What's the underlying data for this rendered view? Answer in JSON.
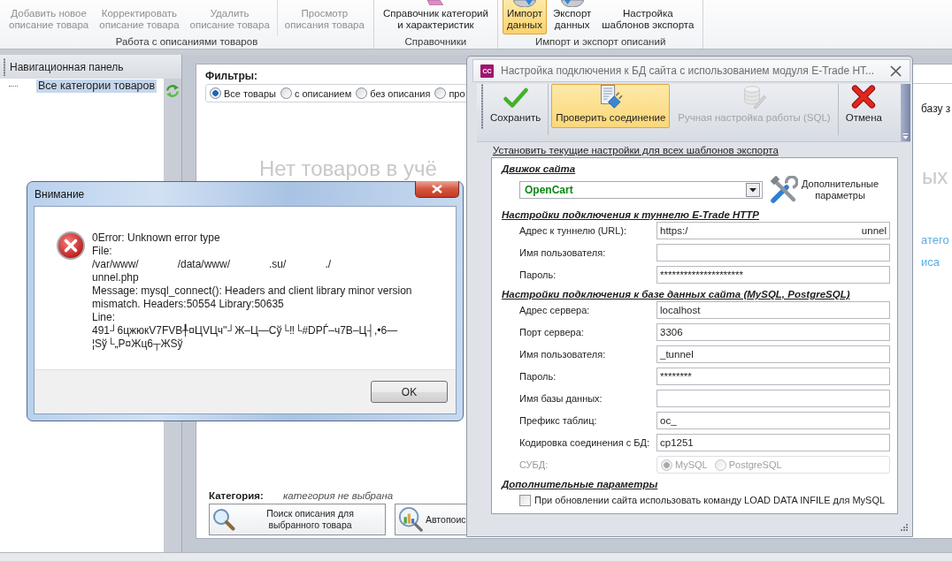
{
  "ribbon": {
    "groups": [
      {
        "label": "Работа с описаниями товаров",
        "sections": [
          {
            "buttons": [
              {
                "kind": "plain",
                "label": "Добавить новое\nописание товара",
                "disabled": true,
                "selected": false
              },
              {
                "kind": "plain",
                "label": "Корректировать\nописание товара",
                "disabled": true,
                "selected": false
              },
              {
                "kind": "plain",
                "label": "Удалить\nописание товара",
                "disabled": true,
                "selected": false
              }
            ]
          },
          {
            "buttons": [
              {
                "kind": "plain",
                "label": "Просмотр\nописания товара",
                "disabled": true,
                "selected": false
              }
            ]
          }
        ]
      },
      {
        "label": "Справочники",
        "sections": [
          {
            "buttons": [
              {
                "kind": "book",
                "label": "Справочник категорий\nи характеристик",
                "disabled": false,
                "selected": false
              }
            ]
          }
        ]
      },
      {
        "label": "Импорт и экспорт описаний",
        "sections": [
          {
            "buttons": [
              {
                "kind": "import",
                "label": "Импорт\nданных",
                "disabled": false,
                "selected": true
              },
              {
                "kind": "export",
                "label": "Экспорт\nданных",
                "disabled": false,
                "selected": false
              },
              {
                "kind": "plain",
                "label": "Настройка\nшаблонов экспорта",
                "disabled": false,
                "selected": false
              }
            ]
          }
        ]
      }
    ]
  },
  "nav_panel": {
    "title": "Навигационная панель",
    "tree": [
      {
        "label": "Все категории товаров",
        "selected": true
      }
    ]
  },
  "filters": {
    "title": "Фильтры:",
    "options": [
      {
        "label": "Все товары",
        "selected": true
      },
      {
        "label": "с описанием",
        "selected": false
      },
      {
        "label": "без описания",
        "selected": false
      },
      {
        "label": "про",
        "selected": false
      }
    ]
  },
  "empty_state": "Нет товаров в учё",
  "category": {
    "label": "Категория:",
    "value": "категория не выбрана"
  },
  "actions": [
    {
      "kind": "search",
      "label": "Поиск описания для\nвыбранного товара"
    },
    {
      "kind": "auto_search",
      "label": "Автопоис"
    }
  ],
  "right_edge": {
    "hint": "базу з",
    "empty_state": "ых",
    "links": [
      "атего",
      "иса"
    ]
  },
  "error_dialog": {
    "title": "Внимание",
    "lines": [
      {
        "kind": "text",
        "text": "0Error: Unknown error type"
      },
      {
        "kind": "text",
        "text": "File:"
      },
      {
        "kind": "gapped",
        "parts": [
          "/var/www/",
          "/data/www/",
          ".su/",
          "./"
        ]
      },
      {
        "kind": "text",
        "text": "unnel.php"
      },
      {
        "kind": "text",
        "text": "Message: mysql_connect(): Headers and client library minor version"
      },
      {
        "kind": "text",
        "text": "mismatch. Headers:50554 Library:50635"
      },
      {
        "kind": "text",
        "text": "Line:"
      },
      {
        "kind": "text",
        "text": "491┘6цжюкV7FVB╀¤ЦVЦч''┘Ж–Ц—Сў└‼└#DPЃ–ч7В–Ц┤,•6—¦Sў└„Р¤Жц6┬ЖSў"
      }
    ],
    "ok_button": "OK"
  },
  "connection_dialog": {
    "logo": "CC",
    "title": "Настройка подключения к БД сайта с использованием модуля E-Trade HT...",
    "toolbar_groups": [
      {
        "buttons": [
          {
            "kind": "save",
            "label": "Сохранить",
            "selected": false,
            "disabled": false
          }
        ]
      },
      {
        "buttons": [
          {
            "kind": "test",
            "label": "Проверить соединение",
            "selected": true,
            "disabled": false
          },
          {
            "kind": "sql",
            "label": "Ручная настройка работы (SQL)",
            "selected": false,
            "disabled": true
          }
        ]
      },
      {
        "buttons": [
          {
            "kind": "cancel",
            "label": "Отмена",
            "selected": false,
            "disabled": false
          }
        ]
      }
    ],
    "apply_link": "Установить текущие настройки для всех шаблонов экспорта",
    "engine": {
      "title": "Движок сайта",
      "value": "OpenCart",
      "extra_button": "Дополнительные\nпараметры"
    },
    "sections": [
      {
        "title": "Настройки подключения к туннелю E-Trade HTTP",
        "fields": [
          {
            "kind": "text",
            "label": "Адрес к туннелю (URL):",
            "value_parts": [
              "https:/",
              "unnel"
            ],
            "disabled": false
          },
          {
            "kind": "text",
            "label": "Имя пользователя:",
            "disabled": false
          },
          {
            "kind": "text",
            "label": "Пароль:",
            "value": "*********************",
            "disabled": false
          }
        ]
      },
      {
        "title": "Настройки подключения к базе данных сайта (MySQL, PostgreSQL)",
        "fields": [
          {
            "kind": "text",
            "label": "Адрес сервера:",
            "value": "localhost",
            "disabled": false
          },
          {
            "kind": "text",
            "label": "Порт сервера:",
            "value": "3306",
            "disabled": false
          },
          {
            "kind": "text",
            "label": "Имя пользователя:",
            "value": "_tunnel",
            "disabled": false
          },
          {
            "kind": "text",
            "label": "Пароль:",
            "value": "********",
            "disabled": false
          },
          {
            "kind": "text",
            "label": "Имя базы данных:",
            "disabled": false
          },
          {
            "kind": "text",
            "label": "Префикс таблиц:",
            "value": "oc_",
            "disabled": false
          },
          {
            "kind": "text",
            "label": "Кодировка соединения с БД:",
            "value": "cp1251",
            "disabled": false
          },
          {
            "kind": "radio",
            "label": "СУБД:",
            "disabled": true,
            "options": [
              {
                "label": "MySQL",
                "selected": true
              },
              {
                "label": "PostgreSQL",
                "selected": false
              }
            ]
          }
        ]
      },
      {
        "title": "Дополнительные параметры",
        "fields": [
          {
            "kind": "checkbox",
            "label": "При обновлении сайта использовать команду LOAD DATA INFILE для MySQL",
            "checked": false,
            "disabled": false
          }
        ]
      }
    ]
  }
}
